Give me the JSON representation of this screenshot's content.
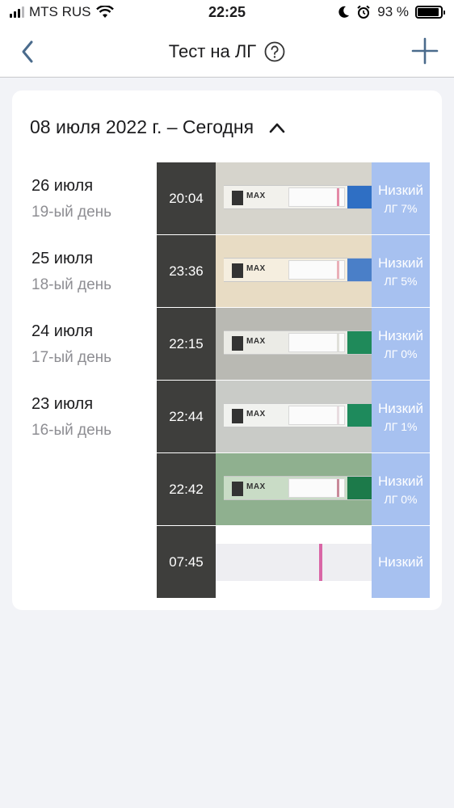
{
  "status_bar": {
    "carrier": "MTS RUS",
    "time": "22:25",
    "battery": "93 %",
    "battery_level": 0.93
  },
  "nav": {
    "title": "Тест на ЛГ",
    "back_icon": "chevron-left-icon",
    "help_icon": "question-circle-icon",
    "add_icon": "plus-icon"
  },
  "card": {
    "header": "08 июля 2022 г. – Сегодня",
    "collapse_icon": "chevron-up-icon",
    "dates": [
      {
        "date": "26 июля",
        "day": "19-ый день"
      },
      {
        "date": "25 июля",
        "day": "18-ый день"
      },
      {
        "date": "24 июля",
        "day": "17-ый день"
      },
      {
        "date": "23 июля",
        "day": "16-ый день"
      }
    ],
    "tests": [
      {
        "time": "20:04",
        "level": "Низкий",
        "lh": "ЛГ 7%",
        "photo_bg": "#d6d4cc",
        "strip_bg": "#f2f1ec",
        "handle": "#2f6fc4",
        "strip_label": "MAX",
        "line_color": "#e48aa6"
      },
      {
        "time": "23:36",
        "level": "Низкий",
        "lh": "ЛГ 5%",
        "photo_bg": "#e8dcc4",
        "strip_bg": "#f5eedf",
        "handle": "#4a7fc8",
        "strip_label": "MAX",
        "line_color": "#eab0b8"
      },
      {
        "time": "22:15",
        "level": "Низкий",
        "lh": "ЛГ 0%",
        "photo_bg": "#b9b9b3",
        "strip_bg": "#ebebe6",
        "handle": "#1f8a5a",
        "strip_label": "MAX",
        "line_color": "#e0e0da"
      },
      {
        "time": "22:44",
        "level": "Низкий",
        "lh": "ЛГ 1%",
        "photo_bg": "#c9cbc7",
        "strip_bg": "#f1f2ef",
        "handle": "#1e8a5c",
        "strip_label": "MAX",
        "line_color": "#e8dde0"
      },
      {
        "time": "22:42",
        "level": "Низкий",
        "lh": "ЛГ 0%",
        "photo_bg": "#8fb08f",
        "strip_bg": "#c9dcc6",
        "handle": "#1c7a4a",
        "strip_label": "MAX",
        "line_color": "#c98a99"
      },
      {
        "time": "07:45",
        "level": "Низкий",
        "lh": "",
        "photo_bg": "#ffffff",
        "strip_bg": "#eeeef2",
        "handle": "",
        "strip_label": "",
        "line_color": "#d966a6"
      }
    ]
  }
}
